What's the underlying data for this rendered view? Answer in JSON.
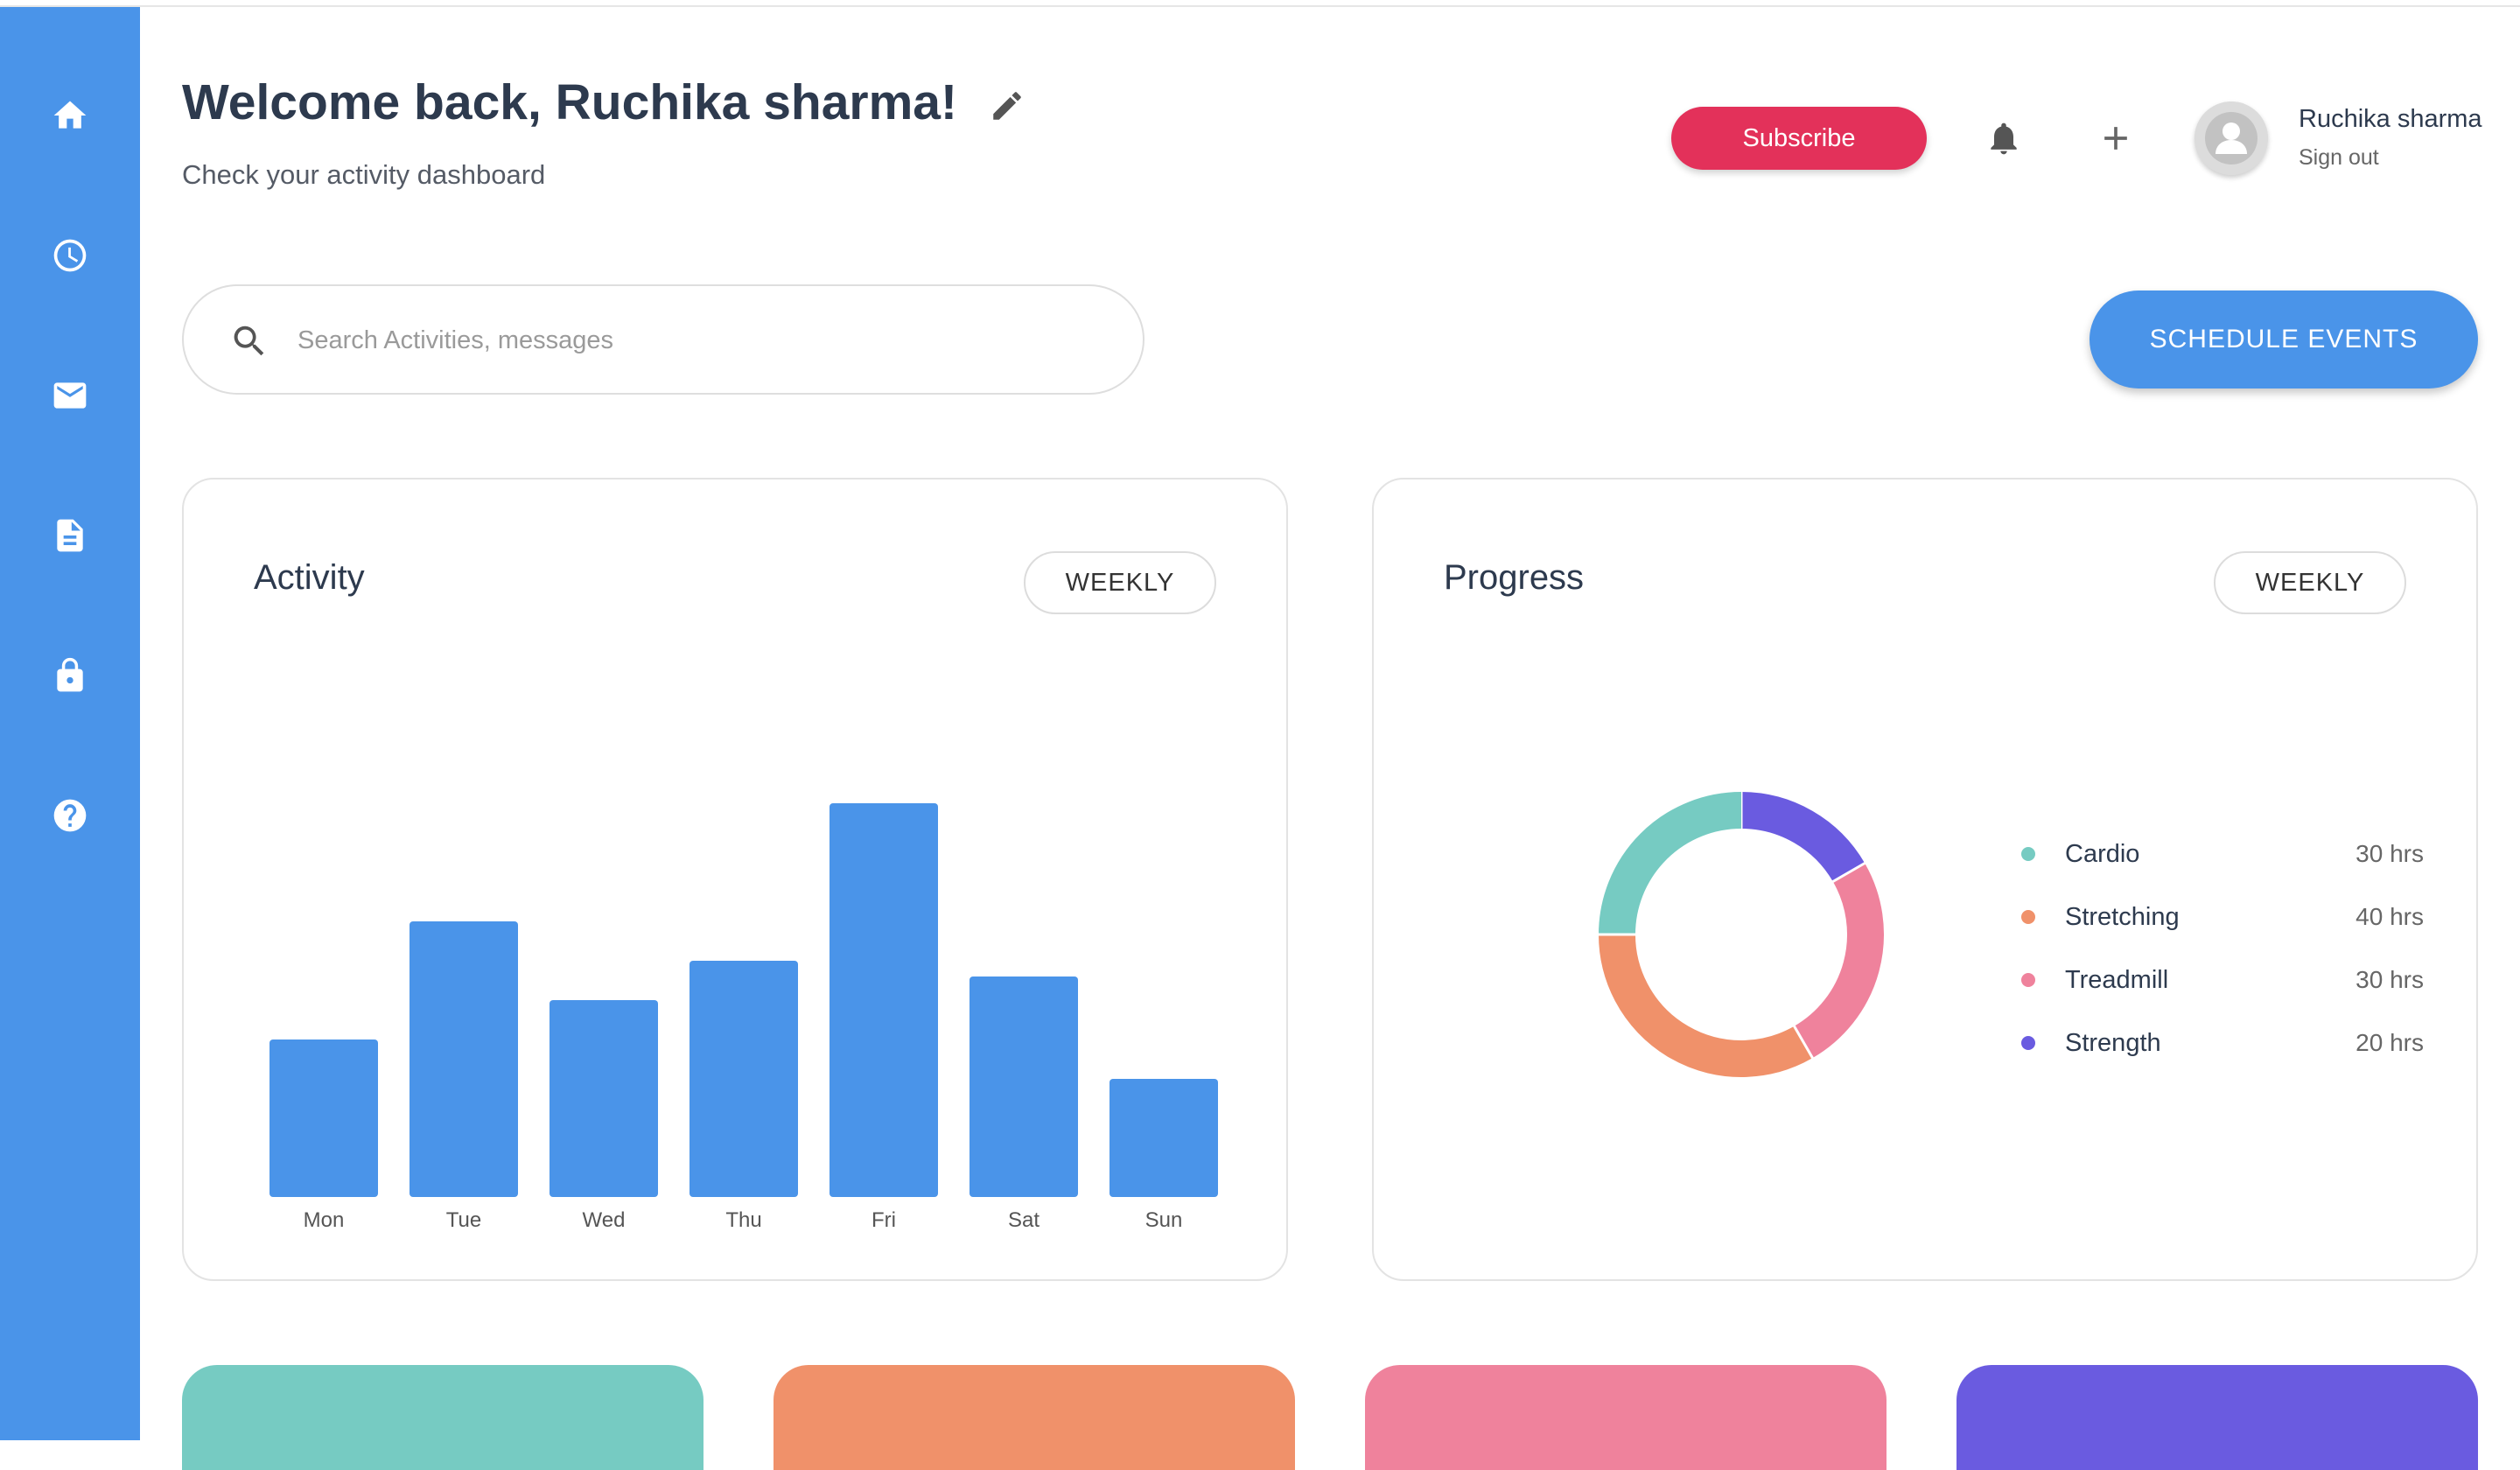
{
  "sidebar": {
    "items": [
      {
        "icon": "home-icon"
      },
      {
        "icon": "clock-icon"
      },
      {
        "icon": "mail-icon"
      },
      {
        "icon": "document-icon"
      },
      {
        "icon": "lock-icon"
      },
      {
        "icon": "help-icon"
      }
    ]
  },
  "header": {
    "welcome": "Welcome back, Ruchika sharma!",
    "subtitle": "Check your activity dashboard",
    "subscribe_label": "Subscribe",
    "user_name": "Ruchika sharma",
    "sign_out_label": "Sign out"
  },
  "search": {
    "placeholder": "Search Activities, messages",
    "value": ""
  },
  "schedule_label": "SCHEDULE EVENTS",
  "activity": {
    "title": "Activity",
    "period_label": "WEEKLY"
  },
  "progress": {
    "title": "Progress",
    "period_label": "WEEKLY",
    "legend": [
      {
        "label": "Cardio",
        "value": "30 hrs",
        "color": "#76cbc2"
      },
      {
        "label": "Stretching",
        "value": "40 hrs",
        "color": "#f0916a"
      },
      {
        "label": "Treadmill",
        "value": "30 hrs",
        "color": "#ef829c"
      },
      {
        "label": "Strength",
        "value": "20 hrs",
        "color": "#6a5be0"
      }
    ]
  },
  "colors": {
    "accent": "#4a94e9",
    "subscribe": "#e3315a",
    "tiles": [
      "#76cbc2",
      "#f0916a",
      "#ef829c",
      "#6a5be0"
    ]
  },
  "chart_data": [
    {
      "type": "bar",
      "categories": [
        "Mon",
        "Tue",
        "Wed",
        "Thu",
        "Fri",
        "Sat",
        "Sun"
      ],
      "values": [
        40,
        70,
        50,
        60,
        100,
        56,
        30
      ],
      "ylim": [
        0,
        100
      ],
      "color": "#4a94e9",
      "grid": false
    },
    {
      "type": "pie",
      "donut": true,
      "labels": [
        "Cardio",
        "Stretching",
        "Treadmill",
        "Strength"
      ],
      "values": [
        30,
        40,
        30,
        20
      ],
      "colors": [
        "#76cbc2",
        "#f0916a",
        "#ef829c",
        "#6a5be0"
      ]
    }
  ]
}
